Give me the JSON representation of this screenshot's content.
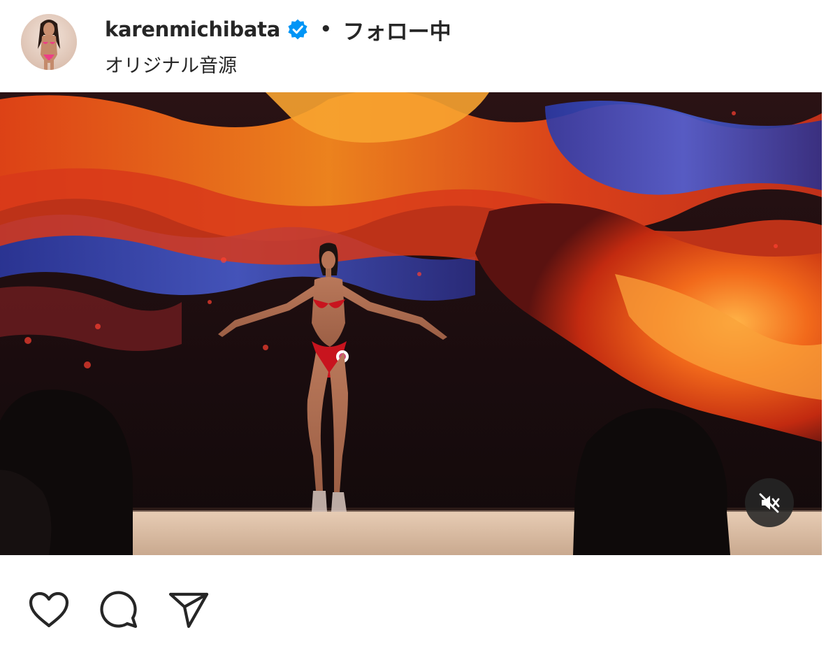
{
  "header": {
    "username": "karenmichibata",
    "separator": "•",
    "follow_label": "フォロー中",
    "audio_label": "オリジナル音源"
  },
  "icons": {
    "verified": "verified-badge-icon",
    "mute": "speaker-muted-icon",
    "like": "heart-icon",
    "comment": "comment-bubble-icon",
    "share": "paper-plane-icon"
  },
  "colors": {
    "verified_blue": "#0095f6",
    "text": "#262626",
    "mute_bg": "#262626"
  }
}
